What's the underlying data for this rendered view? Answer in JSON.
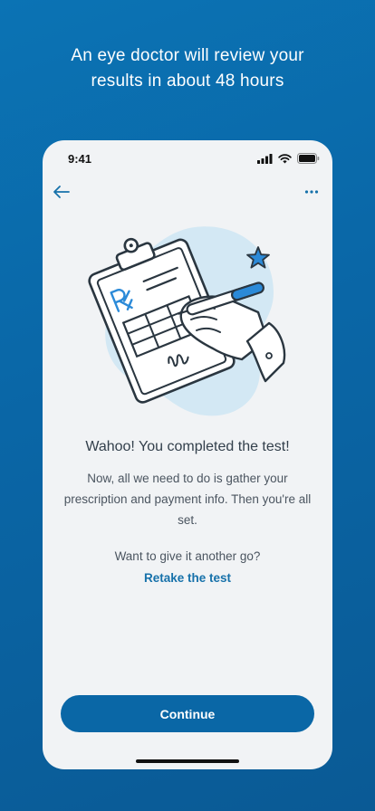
{
  "headline": {
    "line1": "An eye doctor will review your",
    "line2": "results in about 48 hours"
  },
  "status_bar": {
    "time": "9:41",
    "icons": [
      "signal-icon",
      "wifi-icon",
      "battery-icon"
    ]
  },
  "nav": {
    "back_icon": "back-arrow-icon",
    "more_icon": "more-dots-icon"
  },
  "illustration": {
    "icon": "prescription-clipboard-illustration"
  },
  "content": {
    "title": "Wahoo! You completed the test!",
    "body": "Now, all we need to do is gather your prescription and payment info. Then you're all set.",
    "retry_question": "Want to give it another go?",
    "retake_link": "Retake the test"
  },
  "footer": {
    "continue_label": "Continue"
  },
  "colors": {
    "background": "#0b6eae",
    "screen": "#f1f3f5",
    "primary": "#0a67a6",
    "link": "#1671aa",
    "accent": "#2b8ad8",
    "blob": "#d3e8f4"
  }
}
